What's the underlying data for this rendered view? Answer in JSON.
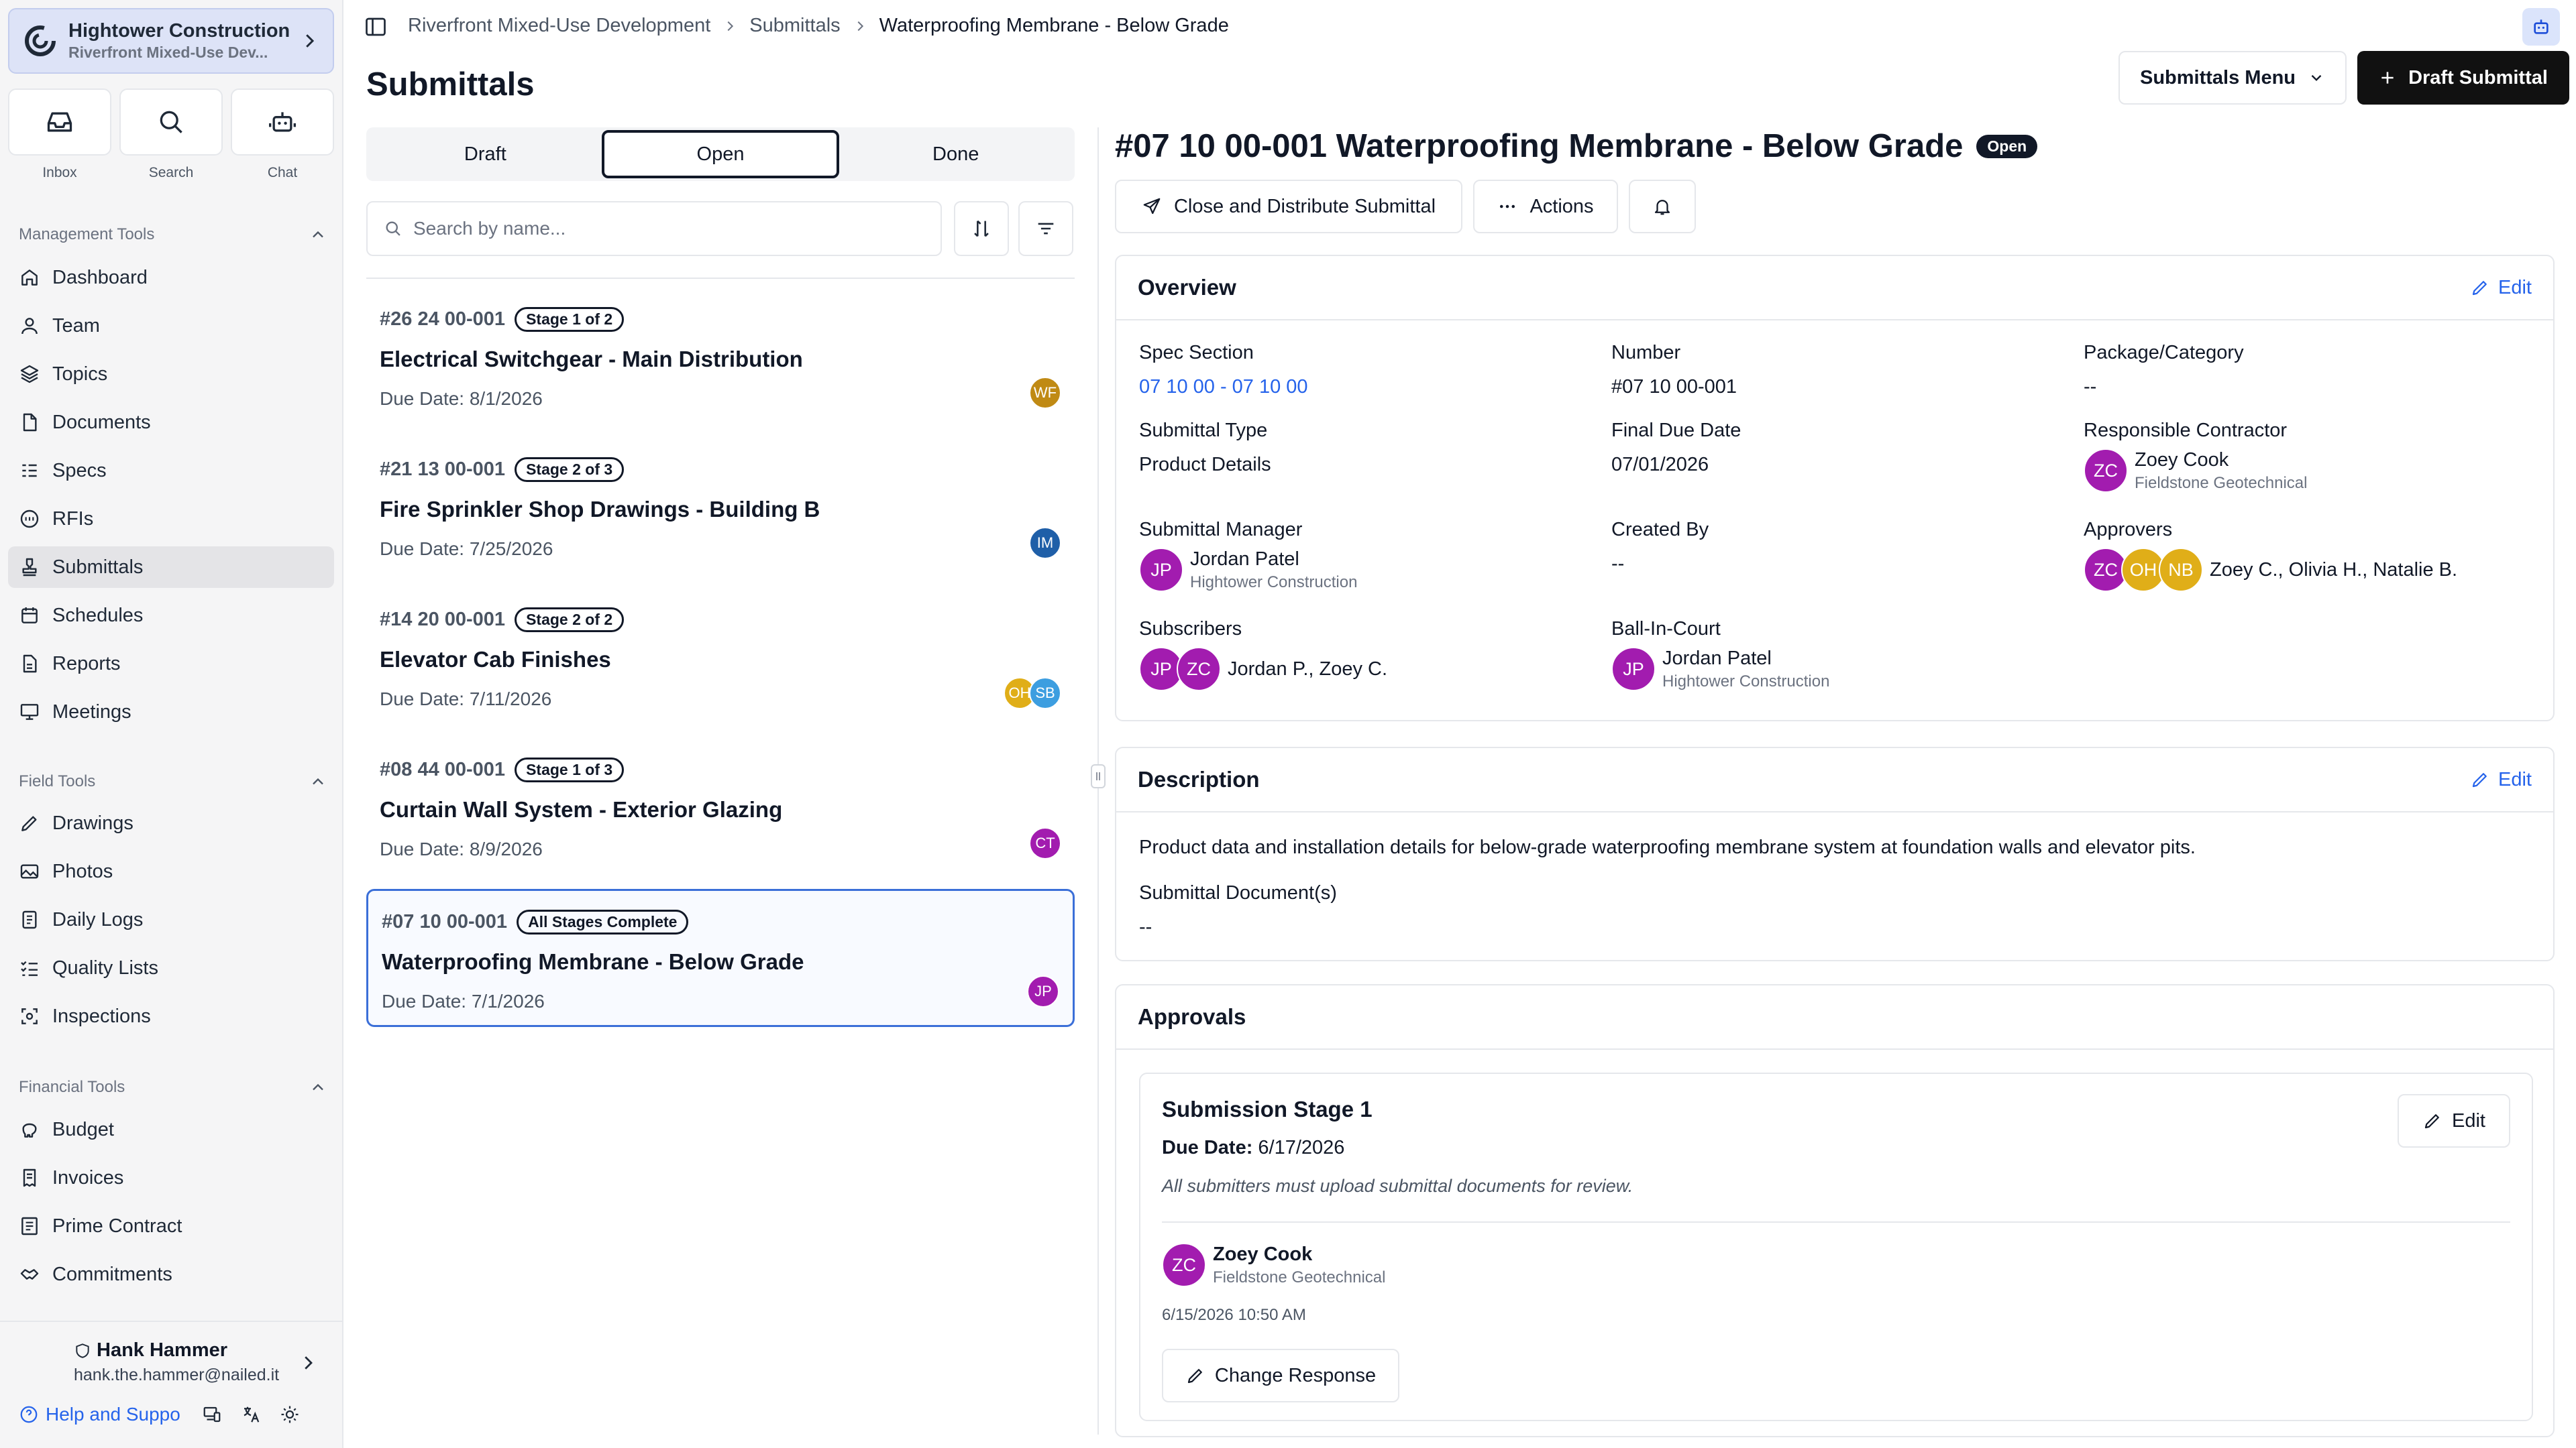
{
  "org": {
    "name": "Hightower Construction",
    "project": "Riverfront Mixed-Use Dev..."
  },
  "quick_actions": [
    {
      "label": "Inbox",
      "icon": "inbox-icon"
    },
    {
      "label": "Search",
      "icon": "search-icon"
    },
    {
      "label": "Chat",
      "icon": "bot-icon"
    }
  ],
  "sidebar": {
    "management_label": "Management Tools",
    "management": [
      "Dashboard",
      "Team",
      "Topics",
      "Documents",
      "Specs",
      "RFIs",
      "Submittals",
      "Schedules",
      "Reports",
      "Meetings"
    ],
    "field_label": "Field Tools",
    "field": [
      "Drawings",
      "Photos",
      "Daily Logs",
      "Quality Lists",
      "Inspections"
    ],
    "financial_label": "Financial Tools",
    "financial": [
      "Budget",
      "Invoices",
      "Prime Contract",
      "Commitments"
    ],
    "active": "Submittals"
  },
  "user": {
    "name": "Hank Hammer",
    "email": "hank.the.hammer@nailed.it",
    "help_label": "Help and Suppo"
  },
  "breadcrumb": {
    "project": "Riverfront Mixed-Use Development",
    "section": "Submittals",
    "current": "Waterproofing Membrane - Below Grade"
  },
  "page": {
    "title": "Submittals",
    "menu_label": "Submittals Menu",
    "draft_label": "Draft Submittal"
  },
  "tabs": [
    "Draft",
    "Open",
    "Done"
  ],
  "active_tab": "Open",
  "search": {
    "placeholder": "Search by name..."
  },
  "submittals": [
    {
      "number": "#26 24 00-001",
      "stage": "Stage 1 of 2",
      "title": "Electrical Switchgear - Main Distribution",
      "due": "Due Date: 8/1/2026",
      "avatars": [
        {
          "initials": "WF",
          "color": "#c08a14"
        }
      ]
    },
    {
      "number": "#21 13 00-001",
      "stage": "Stage 2 of 3",
      "title": "Fire Sprinkler Shop Drawings - Building B",
      "due": "Due Date: 7/25/2026",
      "avatars": [
        {
          "initials": "IM",
          "color": "#1f5fa8"
        }
      ]
    },
    {
      "number": "#14 20 00-001",
      "stage": "Stage 2 of 2",
      "title": "Elevator Cab Finishes",
      "due": "Due Date: 7/11/2026",
      "avatars": [
        {
          "initials": "OH",
          "color": "#e0ae18"
        },
        {
          "initials": "SB",
          "color": "#3d9ee0"
        }
      ]
    },
    {
      "number": "#08 44 00-001",
      "stage": "Stage 1 of 3",
      "title": "Curtain Wall System - Exterior Glazing",
      "due": "Due Date: 8/9/2026",
      "avatars": [
        {
          "initials": "CT",
          "color": "#a21caf"
        }
      ]
    },
    {
      "number": "#07 10 00-001",
      "stage": "All Stages Complete",
      "title": "Waterproofing Membrane - Below Grade",
      "due": "Due Date: 7/1/2026",
      "avatars": [
        {
          "initials": "JP",
          "color": "#a21caf"
        }
      ]
    }
  ],
  "detail": {
    "title": "#07 10 00-001 Waterproofing Membrane - Below Grade",
    "status": "Open",
    "close_label": "Close and Distribute Submittal",
    "actions_label": "Actions",
    "overview": {
      "heading": "Overview",
      "edit": "Edit",
      "spec_label": "Spec Section",
      "spec_value": "07 10 00 - 07 10 00",
      "number_label": "Number",
      "number_value": "#07 10 00-001",
      "package_label": "Package/Category",
      "package_value": "--",
      "type_label": "Submittal Type",
      "type_value": "Product Details",
      "final_due_label": "Final Due Date",
      "final_due_value": "07/01/2026",
      "contractor_label": "Responsible Contractor",
      "contractor_initials": "ZC",
      "contractor_name": "Zoey Cook",
      "contractor_org": "Fieldstone Geotechnical",
      "manager_label": "Submittal Manager",
      "manager_initials": "JP",
      "manager_name": "Jordan Patel",
      "manager_org": "Hightower Construction",
      "created_label": "Created By",
      "created_value": "--",
      "approvers_label": "Approvers",
      "approvers_initials": [
        "ZC",
        "OH",
        "NB"
      ],
      "approvers_names": "Zoey C., Olivia H., Natalie B.",
      "subscribers_label": "Subscribers",
      "subscribers_initials": [
        "JP",
        "ZC"
      ],
      "subscribers_names": "Jordan P., Zoey C.",
      "bic_label": "Ball-In-Court",
      "bic_initials": "JP",
      "bic_name": "Jordan Patel",
      "bic_org": "Hightower Construction"
    },
    "description": {
      "heading": "Description",
      "edit": "Edit",
      "text": "Product data and installation details for below-grade waterproofing membrane system at foundation walls and elevator pits.",
      "docs_label": "Submittal Document(s)",
      "docs_value": "--"
    },
    "approvals": {
      "heading": "Approvals",
      "stage_title": "Submission Stage 1",
      "due_label": "Due Date:",
      "due_value": "6/17/2026",
      "note": "All submitters must upload submittal documents for review.",
      "edit": "Edit",
      "responder_initials": "ZC",
      "responder_name": "Zoey Cook",
      "responder_org": "Fieldstone Geotechnical",
      "timestamp": "6/15/2026 10:50 AM",
      "change_label": "Change Response"
    }
  },
  "colors": {
    "purple": "#a21caf",
    "amber": "#e0ae18",
    "blue_link": "#2563eb",
    "selection": "#3b6fd8"
  }
}
